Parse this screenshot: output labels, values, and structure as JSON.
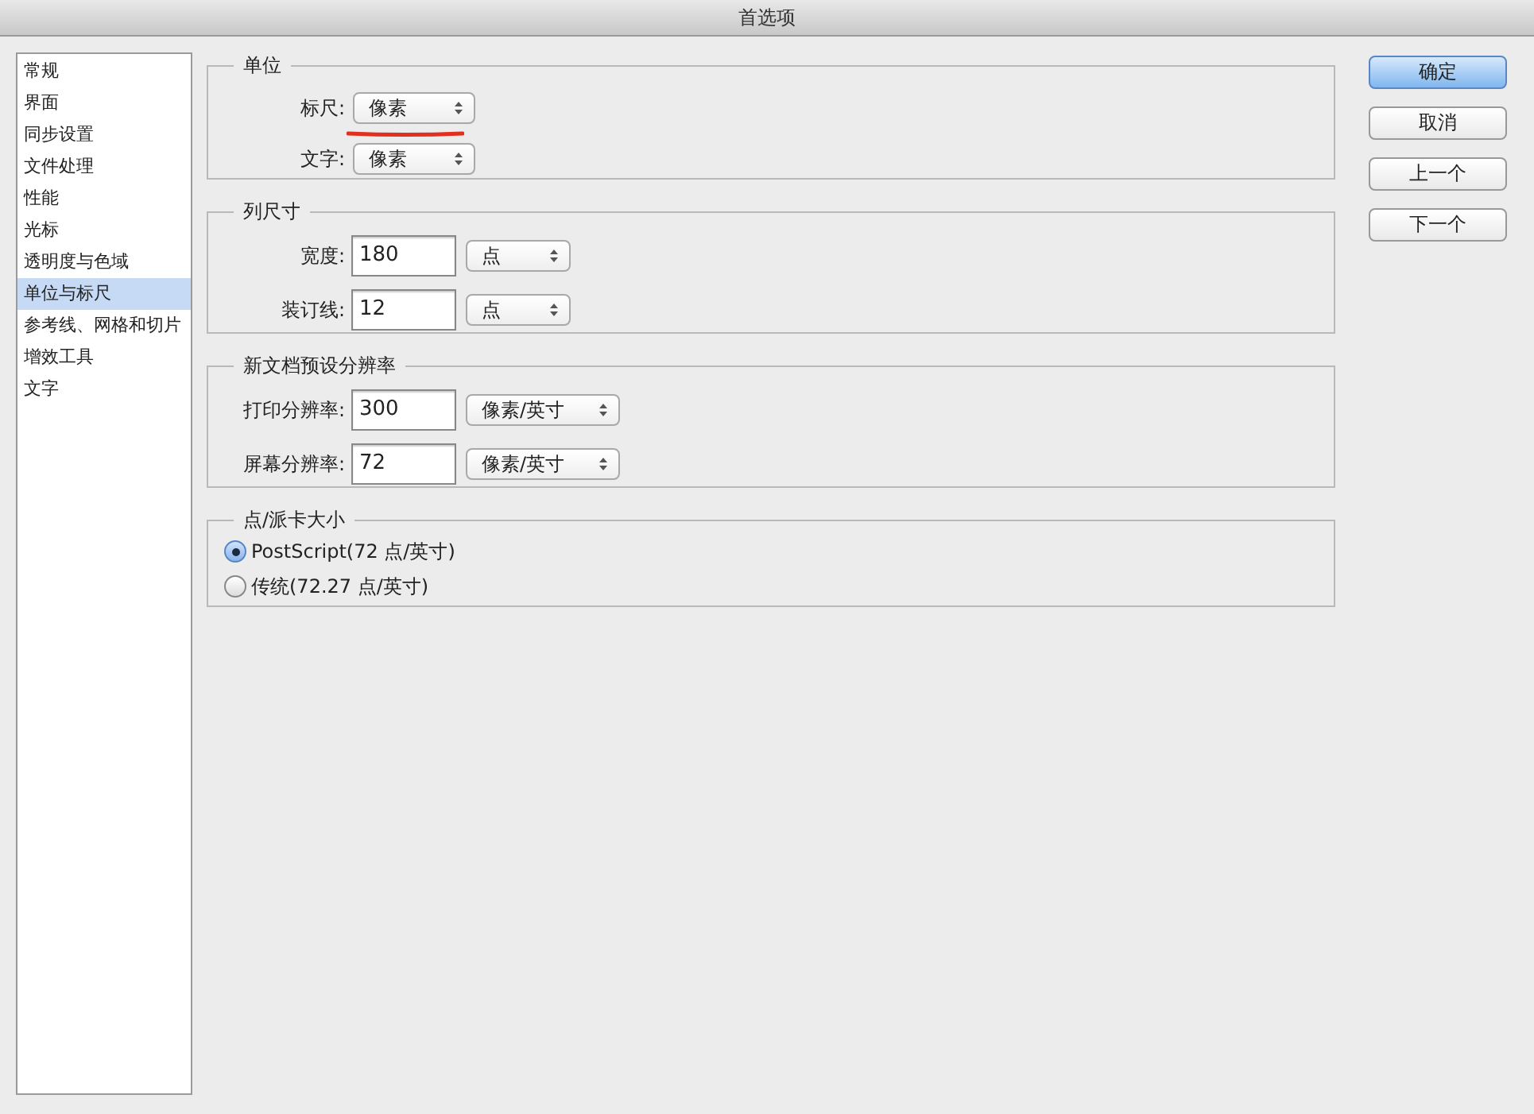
{
  "window": {
    "title": "首选项"
  },
  "sidebar": {
    "items": [
      {
        "label": "常规",
        "selected": false
      },
      {
        "label": "界面",
        "selected": false
      },
      {
        "label": "同步设置",
        "selected": false
      },
      {
        "label": "文件处理",
        "selected": false
      },
      {
        "label": "性能",
        "selected": false
      },
      {
        "label": "光标",
        "selected": false
      },
      {
        "label": "透明度与色域",
        "selected": false
      },
      {
        "label": "单位与标尺",
        "selected": true
      },
      {
        "label": "参考线、网格和切片",
        "selected": false
      },
      {
        "label": "增效工具",
        "selected": false
      },
      {
        "label": "文字",
        "selected": false
      }
    ]
  },
  "groups": [
    {
      "title": "单位",
      "rows": [
        {
          "kind": "select",
          "label": "标尺:",
          "select": "像素",
          "underlined": true
        },
        {
          "kind": "select",
          "label": "文字:",
          "select": "像素",
          "underlined": false
        }
      ]
    },
    {
      "title": "列尺寸",
      "rows": [
        {
          "kind": "input_select",
          "label": "宽度:",
          "value": "180",
          "select": "点"
        },
        {
          "kind": "input_select",
          "label": "装订线:",
          "value": "12",
          "select": "点"
        }
      ]
    },
    {
      "title": "新文档预设分辨率",
      "rows": [
        {
          "kind": "input_select",
          "label": "打印分辨率:",
          "value": "300",
          "select": "像素/英寸"
        },
        {
          "kind": "input_select",
          "label": "屏幕分辨率:",
          "value": "72",
          "select": "像素/英寸"
        }
      ]
    },
    {
      "title": "点/派卡大小",
      "rows": [
        {
          "kind": "radio",
          "label": "PostScript(72 点/英寸)",
          "selected": true
        },
        {
          "kind": "radio",
          "label": "传统(72.27 点/英寸)",
          "selected": false
        }
      ]
    }
  ],
  "buttons": [
    {
      "label": "确定",
      "default": true
    },
    {
      "label": "取消",
      "default": false
    },
    {
      "label": "上一个",
      "default": false
    },
    {
      "label": "下一个",
      "default": false
    }
  ]
}
